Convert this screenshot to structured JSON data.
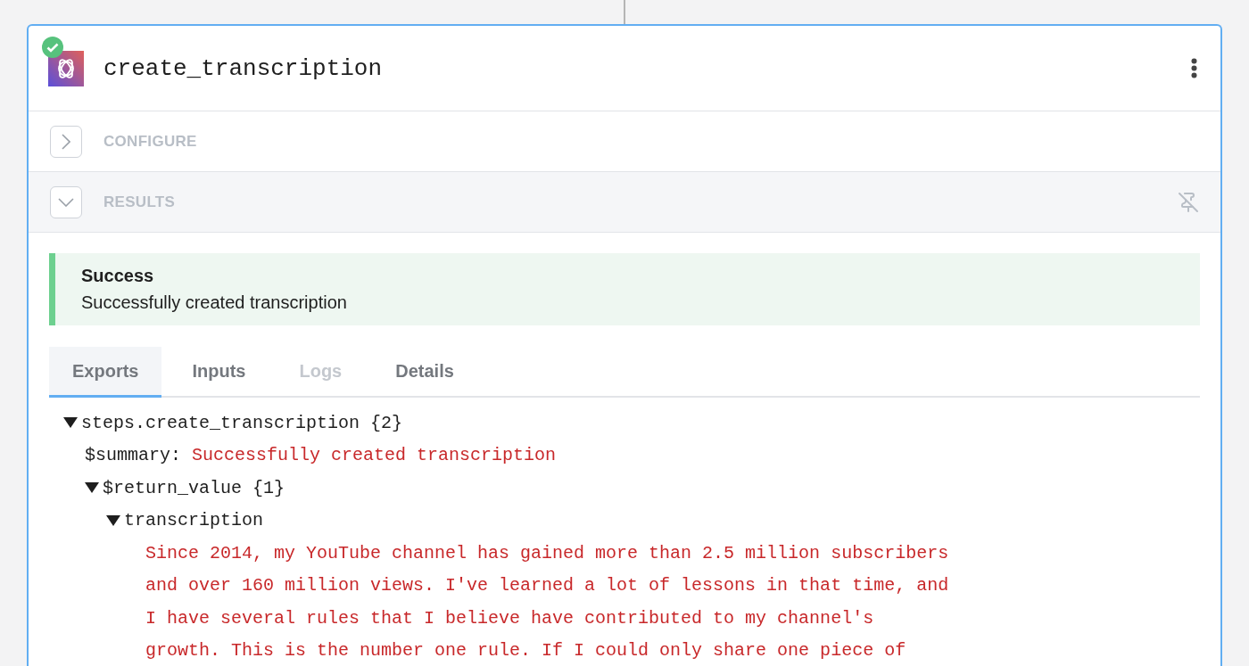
{
  "step": {
    "title": "create_transcription",
    "succeeded": true
  },
  "sections": [
    {
      "label": "CONFIGURE",
      "expanded": false
    },
    {
      "label": "RESULTS",
      "expanded": true
    }
  ],
  "alert": {
    "kind": "success",
    "title": "Success",
    "message": "Successfully created transcription"
  },
  "tabs": [
    {
      "label": "Exports",
      "selected": true,
      "disabled": false
    },
    {
      "label": "Inputs",
      "selected": false,
      "disabled": false
    },
    {
      "label": "Logs",
      "selected": false,
      "disabled": true
    },
    {
      "label": "Details",
      "selected": false,
      "disabled": false
    }
  ],
  "tree": [
    {
      "kind": "node",
      "label": "steps.create_transcription",
      "count": "{2}",
      "expanded": true,
      "children": [
        {
          "kind": "value",
          "key": "$summary:",
          "value": "Successfully created transcription"
        },
        {
          "kind": "node",
          "label": "$return_value",
          "count": "{1}",
          "expanded": true,
          "children": [
            {
              "kind": "node",
              "label": "transcription",
              "expanded": true,
              "children": [
                {
                  "kind": "text",
                  "lines": [
                    "Since 2014, my YouTube channel has gained more than 2.5 million subscribers",
                    "and over 160 million views. I've learned a lot of lessons in that time, and",
                    "I have several rules that I believe have contributed to my channel's",
                    "growth. This is the number one rule. If I could only share one piece of"
                  ]
                }
              ]
            }
          ]
        }
      ]
    }
  ]
}
